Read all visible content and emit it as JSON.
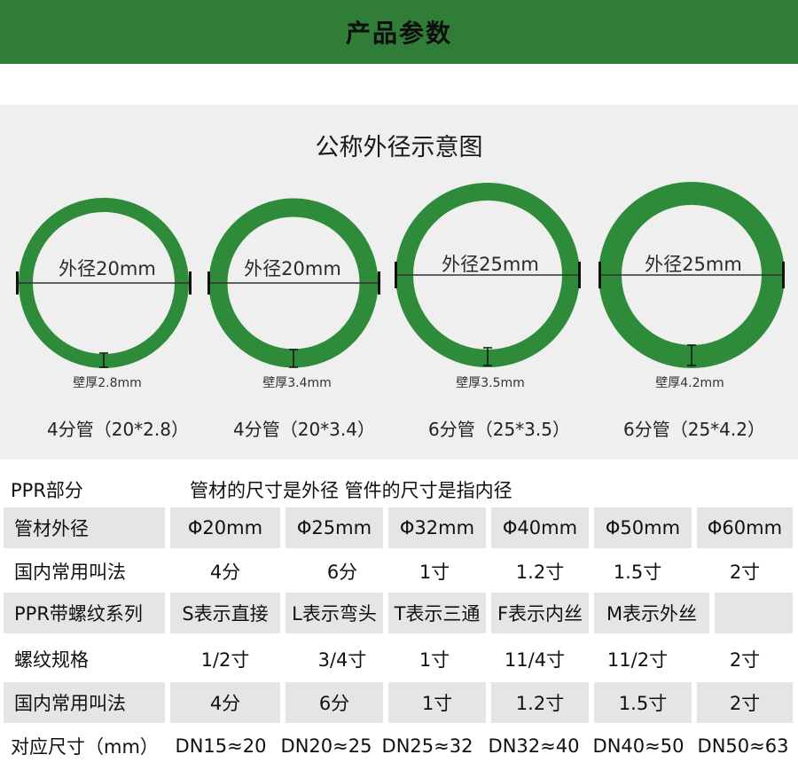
{
  "header": {
    "title": "产品参数"
  },
  "diagram": {
    "title": "公称外径示意图",
    "pipes": [
      {
        "od_label": "外径20mm",
        "wall_label": "壁厚2.8mm",
        "name": "4分管（20*2.8）"
      },
      {
        "od_label": "外径20mm",
        "wall_label": "壁厚3.4mm",
        "name": "4分管（20*3.4）"
      },
      {
        "od_label": "外径25mm",
        "wall_label": "壁厚3.5mm",
        "name": "6分管（25*3.5）"
      },
      {
        "od_label": "外径25mm",
        "wall_label": "壁厚4.2mm",
        "name": "6分管（25*4.2）"
      }
    ],
    "ring_color": "#2e8b3a"
  },
  "table": {
    "section_label": "PPR部分",
    "section_note": "管材的尺寸是外径 管件的尺寸是指内径",
    "rows": [
      {
        "label": "管材外径",
        "cells": [
          "Φ20mm",
          "Φ25mm",
          "Φ32mm",
          "Φ40mm",
          "Φ50mm",
          "Φ60mm"
        ]
      },
      {
        "label": "国内常用叫法",
        "cells": [
          "4分",
          "6分",
          "1寸",
          "1.2寸",
          "1.5寸",
          "2寸"
        ]
      },
      {
        "label": "PPR带螺纹系列",
        "cells": [
          "S表示直接",
          "L表示弯头",
          "T表示三通",
          "F表示内丝",
          "M表示外丝",
          ""
        ]
      },
      {
        "label": "螺纹规格",
        "cells": [
          "1/2寸",
          "3/4寸",
          "1寸",
          "11/4寸",
          "11/2寸",
          "2寸"
        ]
      },
      {
        "label": "国内常用叫法",
        "cells": [
          "4分",
          "6分",
          "1寸",
          "1.2寸",
          "1.5寸",
          "2寸"
        ]
      },
      {
        "label": "对应尺寸（mm）",
        "cells": [
          "DN15≈20",
          "DN20≈25",
          "DN25≈32",
          "DN32≈40",
          "DN40≈50",
          "DN50≈63"
        ]
      }
    ]
  }
}
